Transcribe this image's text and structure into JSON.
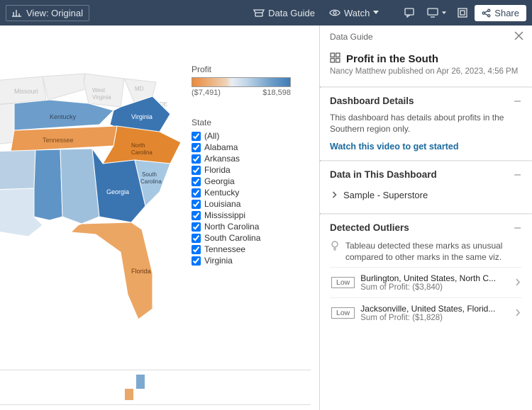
{
  "toolbar": {
    "view_label": "View: Original",
    "data_guide_label": "Data Guide",
    "watch_label": "Watch",
    "share_label": "Share"
  },
  "legend": {
    "title": "Profit",
    "min": "($7,491)",
    "max": "$18,598"
  },
  "filter": {
    "title": "State",
    "items": [
      "(All)",
      "Alabama",
      "Arkansas",
      "Florida",
      "Georgia",
      "Kentucky",
      "Louisiana",
      "Mississippi",
      "North Carolina",
      "South Carolina",
      "Tennessee",
      "Virginia"
    ]
  },
  "guide": {
    "panel_label": "Data Guide",
    "title": "Profit in the South",
    "subtitle": "Nancy Matthew published on Apr 26, 2023, 4:56 PM",
    "details": {
      "heading": "Dashboard Details",
      "desc": "This dashboard has details about profits in the Southern region only.",
      "video_link": "Watch this video to get started"
    },
    "data_section": {
      "heading": "Data in This Dashboard",
      "source": "Sample - Superstore"
    },
    "outliers": {
      "heading": "Detected Outliers",
      "note": "Tableau detected these marks as unusual compared to other marks in the same viz.",
      "items": [
        {
          "badge": "Low",
          "title": "Burlington, United States, North C...",
          "sub": "Sum of Profit: ($3,840)"
        },
        {
          "badge": "Low",
          "title": "Jacksonville, United States, Florid...",
          "sub": "Sum of Profit: ($1,828)"
        }
      ]
    }
  },
  "chart_data": {
    "type": "map",
    "title": "Profit in the South",
    "color_field": "Profit",
    "color_range": [
      -7491,
      18598
    ],
    "states": [
      {
        "name": "Alabama",
        "profit": 5000
      },
      {
        "name": "Arkansas",
        "profit": 3000
      },
      {
        "name": "Florida",
        "profit": -3000
      },
      {
        "name": "Georgia",
        "profit": 15000
      },
      {
        "name": "Kentucky",
        "profit": 10000
      },
      {
        "name": "Louisiana",
        "profit": 1500
      },
      {
        "name": "Mississippi",
        "profit": 9000
      },
      {
        "name": "North Carolina",
        "profit": -7491
      },
      {
        "name": "South Carolina",
        "profit": 5500
      },
      {
        "name": "Tennessee",
        "profit": -5000
      },
      {
        "name": "Virginia",
        "profit": 18598
      }
    ]
  }
}
